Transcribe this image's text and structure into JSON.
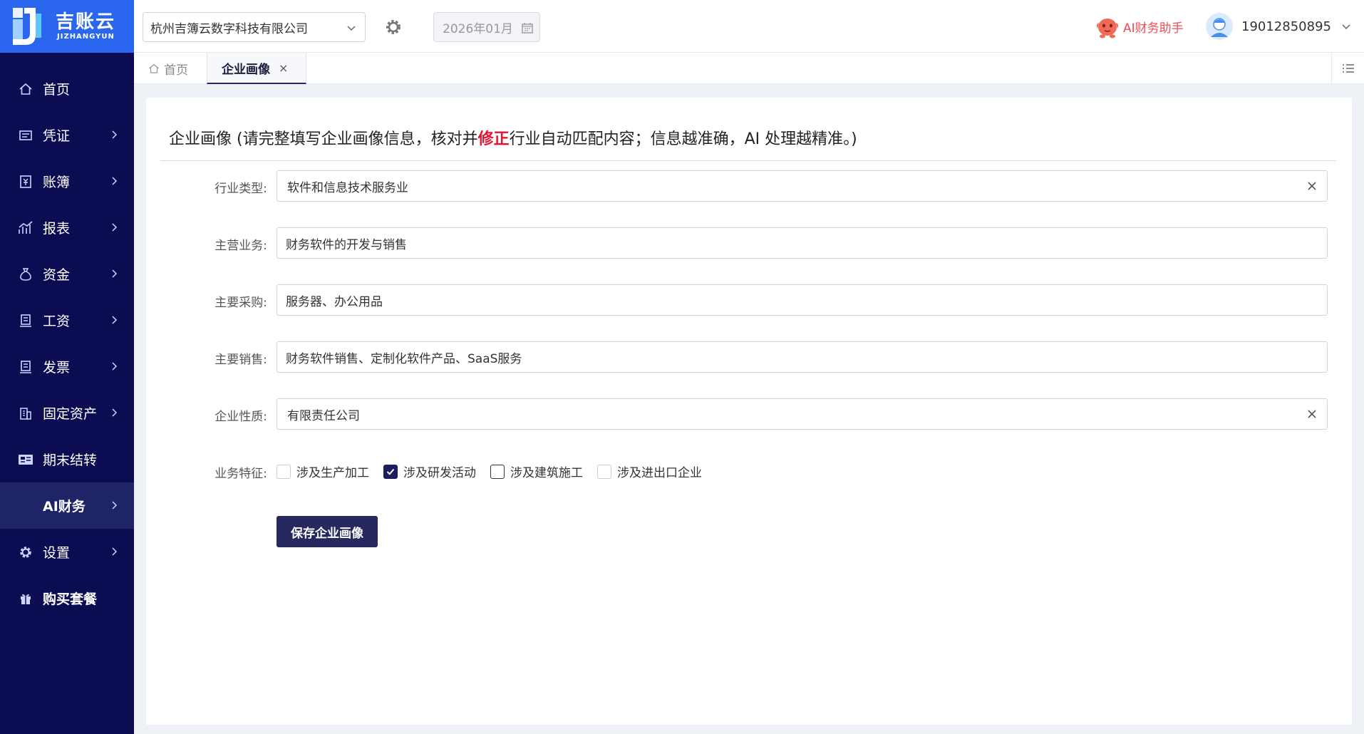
{
  "brand": {
    "name_cn": "吉账云",
    "name_en": "JIZHANGYUN",
    "logo_color": "#2b67ee"
  },
  "header": {
    "company": "杭州吉簿云数字科技有限公司",
    "period": "2026年01月",
    "ai_assistant": "AI财务助手",
    "user_phone": "19012850895"
  },
  "sidebar": {
    "items": [
      {
        "label": "首页",
        "icon": "home-icon"
      },
      {
        "label": "凭证",
        "icon": "voucher-icon"
      },
      {
        "label": "账簿",
        "icon": "ledger-icon"
      },
      {
        "label": "报表",
        "icon": "report-icon"
      },
      {
        "label": "资金",
        "icon": "money-bag-icon"
      },
      {
        "label": "工资",
        "icon": "payroll-icon"
      },
      {
        "label": "发票",
        "icon": "invoice-icon"
      },
      {
        "label": "固定资产",
        "icon": "building-icon"
      },
      {
        "label": "期末结转",
        "icon": "carryover-icon"
      },
      {
        "label": "AI财务",
        "icon": ""
      },
      {
        "label": "设置",
        "icon": "gear-icon"
      },
      {
        "label": "购买套餐",
        "icon": "gift-icon"
      }
    ]
  },
  "tabs": {
    "home": "首页",
    "active": "企业画像",
    "close": "×"
  },
  "page": {
    "title_prefix": "企业画像 (请完整填写企业画像信息，核对并",
    "title_highlight": "修正",
    "title_suffix": "行业自动匹配内容；信息越准确，AI 处理越精准。)"
  },
  "form": {
    "industry": {
      "label": "行业类型:",
      "value": "软件和信息技术服务业"
    },
    "main_business": {
      "label": "主营业务:",
      "value": "财务软件的开发与销售"
    },
    "main_purchase": {
      "label": "主要采购:",
      "value": "服务器、办公用品"
    },
    "main_sales": {
      "label": "主要销售:",
      "value": "财务软件销售、定制化软件产品、SaaS服务"
    },
    "company_type": {
      "label": "企业性质:",
      "value": "有限责任公司"
    },
    "features": {
      "label": "业务特征:",
      "options": [
        {
          "label": "涉及生产加工",
          "checked": false
        },
        {
          "label": "涉及研发活动",
          "checked": true
        },
        {
          "label": "涉及建筑施工",
          "checked": false
        },
        {
          "label": "涉及进出口企业",
          "checked": false
        }
      ]
    },
    "save_label": "保存企业画像"
  }
}
